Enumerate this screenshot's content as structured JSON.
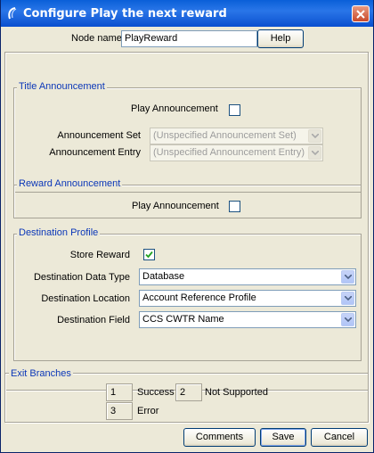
{
  "window": {
    "title": "Configure Play the next reward"
  },
  "node": {
    "label": "Node name",
    "value": "PlayReward",
    "help_label": "Help"
  },
  "title_announcement": {
    "legend": "Title Announcement",
    "play_label": "Play Announcement",
    "play_checked": false,
    "set_label": "Announcement Set",
    "set_value": "(Unspecified Announcement Set)",
    "entry_label": "Announcement Entry",
    "entry_value": "(Unspecified Announcement Entry)"
  },
  "reward_announcement": {
    "legend": "Reward Announcement",
    "play_label": "Play Announcement",
    "play_checked": false
  },
  "destination_profile": {
    "legend": "Destination Profile",
    "store_label": "Store Reward",
    "store_checked": true,
    "data_type_label": "Destination Data Type",
    "data_type_value": "Database",
    "location_label": "Destination Location",
    "location_value": "Account Reference Profile",
    "field_label": "Destination Field",
    "field_value": "CCS CWTR Name"
  },
  "exit_branches": {
    "legend": "Exit Branches",
    "items": [
      {
        "number": "1",
        "label": "Success"
      },
      {
        "number": "2",
        "label": "Not Supported"
      },
      {
        "number": "3",
        "label": "Error"
      }
    ]
  },
  "footer": {
    "comments_label": "Comments",
    "save_label": "Save",
    "cancel_label": "Cancel"
  },
  "colors": {
    "title_bar": "#2a76e8",
    "group_title": "#0b37b8",
    "window_bg": "#ece9d8"
  }
}
